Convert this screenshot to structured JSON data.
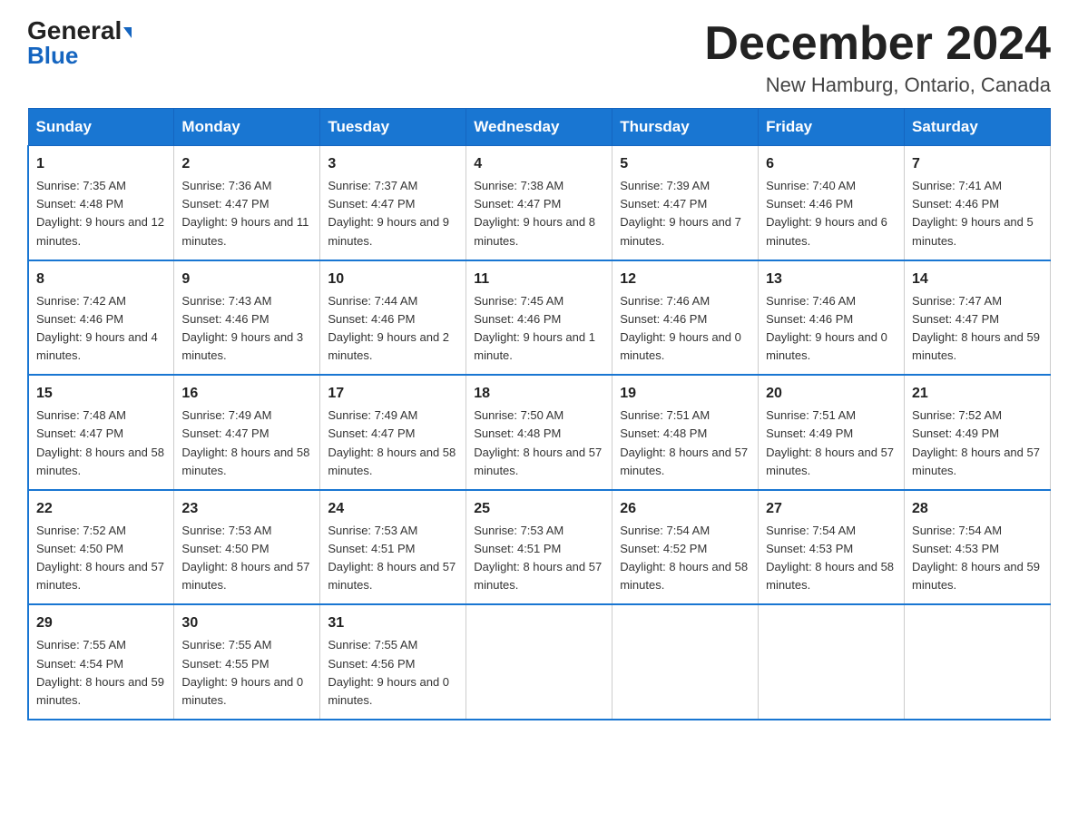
{
  "logo": {
    "general": "General",
    "arrow": "▶",
    "blue": "Blue"
  },
  "header": {
    "title": "December 2024",
    "location": "New Hamburg, Ontario, Canada"
  },
  "days_of_week": [
    "Sunday",
    "Monday",
    "Tuesday",
    "Wednesday",
    "Thursday",
    "Friday",
    "Saturday"
  ],
  "weeks": [
    [
      {
        "day": "1",
        "sunrise": "7:35 AM",
        "sunset": "4:48 PM",
        "daylight": "9 hours and 12 minutes."
      },
      {
        "day": "2",
        "sunrise": "7:36 AM",
        "sunset": "4:47 PM",
        "daylight": "9 hours and 11 minutes."
      },
      {
        "day": "3",
        "sunrise": "7:37 AM",
        "sunset": "4:47 PM",
        "daylight": "9 hours and 9 minutes."
      },
      {
        "day": "4",
        "sunrise": "7:38 AM",
        "sunset": "4:47 PM",
        "daylight": "9 hours and 8 minutes."
      },
      {
        "day": "5",
        "sunrise": "7:39 AM",
        "sunset": "4:47 PM",
        "daylight": "9 hours and 7 minutes."
      },
      {
        "day": "6",
        "sunrise": "7:40 AM",
        "sunset": "4:46 PM",
        "daylight": "9 hours and 6 minutes."
      },
      {
        "day": "7",
        "sunrise": "7:41 AM",
        "sunset": "4:46 PM",
        "daylight": "9 hours and 5 minutes."
      }
    ],
    [
      {
        "day": "8",
        "sunrise": "7:42 AM",
        "sunset": "4:46 PM",
        "daylight": "9 hours and 4 minutes."
      },
      {
        "day": "9",
        "sunrise": "7:43 AM",
        "sunset": "4:46 PM",
        "daylight": "9 hours and 3 minutes."
      },
      {
        "day": "10",
        "sunrise": "7:44 AM",
        "sunset": "4:46 PM",
        "daylight": "9 hours and 2 minutes."
      },
      {
        "day": "11",
        "sunrise": "7:45 AM",
        "sunset": "4:46 PM",
        "daylight": "9 hours and 1 minute."
      },
      {
        "day": "12",
        "sunrise": "7:46 AM",
        "sunset": "4:46 PM",
        "daylight": "9 hours and 0 minutes."
      },
      {
        "day": "13",
        "sunrise": "7:46 AM",
        "sunset": "4:46 PM",
        "daylight": "9 hours and 0 minutes."
      },
      {
        "day": "14",
        "sunrise": "7:47 AM",
        "sunset": "4:47 PM",
        "daylight": "8 hours and 59 minutes."
      }
    ],
    [
      {
        "day": "15",
        "sunrise": "7:48 AM",
        "sunset": "4:47 PM",
        "daylight": "8 hours and 58 minutes."
      },
      {
        "day": "16",
        "sunrise": "7:49 AM",
        "sunset": "4:47 PM",
        "daylight": "8 hours and 58 minutes."
      },
      {
        "day": "17",
        "sunrise": "7:49 AM",
        "sunset": "4:47 PM",
        "daylight": "8 hours and 58 minutes."
      },
      {
        "day": "18",
        "sunrise": "7:50 AM",
        "sunset": "4:48 PM",
        "daylight": "8 hours and 57 minutes."
      },
      {
        "day": "19",
        "sunrise": "7:51 AM",
        "sunset": "4:48 PM",
        "daylight": "8 hours and 57 minutes."
      },
      {
        "day": "20",
        "sunrise": "7:51 AM",
        "sunset": "4:49 PM",
        "daylight": "8 hours and 57 minutes."
      },
      {
        "day": "21",
        "sunrise": "7:52 AM",
        "sunset": "4:49 PM",
        "daylight": "8 hours and 57 minutes."
      }
    ],
    [
      {
        "day": "22",
        "sunrise": "7:52 AM",
        "sunset": "4:50 PM",
        "daylight": "8 hours and 57 minutes."
      },
      {
        "day": "23",
        "sunrise": "7:53 AM",
        "sunset": "4:50 PM",
        "daylight": "8 hours and 57 minutes."
      },
      {
        "day": "24",
        "sunrise": "7:53 AM",
        "sunset": "4:51 PM",
        "daylight": "8 hours and 57 minutes."
      },
      {
        "day": "25",
        "sunrise": "7:53 AM",
        "sunset": "4:51 PM",
        "daylight": "8 hours and 57 minutes."
      },
      {
        "day": "26",
        "sunrise": "7:54 AM",
        "sunset": "4:52 PM",
        "daylight": "8 hours and 58 minutes."
      },
      {
        "day": "27",
        "sunrise": "7:54 AM",
        "sunset": "4:53 PM",
        "daylight": "8 hours and 58 minutes."
      },
      {
        "day": "28",
        "sunrise": "7:54 AM",
        "sunset": "4:53 PM",
        "daylight": "8 hours and 59 minutes."
      }
    ],
    [
      {
        "day": "29",
        "sunrise": "7:55 AM",
        "sunset": "4:54 PM",
        "daylight": "8 hours and 59 minutes."
      },
      {
        "day": "30",
        "sunrise": "7:55 AM",
        "sunset": "4:55 PM",
        "daylight": "9 hours and 0 minutes."
      },
      {
        "day": "31",
        "sunrise": "7:55 AM",
        "sunset": "4:56 PM",
        "daylight": "9 hours and 0 minutes."
      },
      null,
      null,
      null,
      null
    ]
  ]
}
